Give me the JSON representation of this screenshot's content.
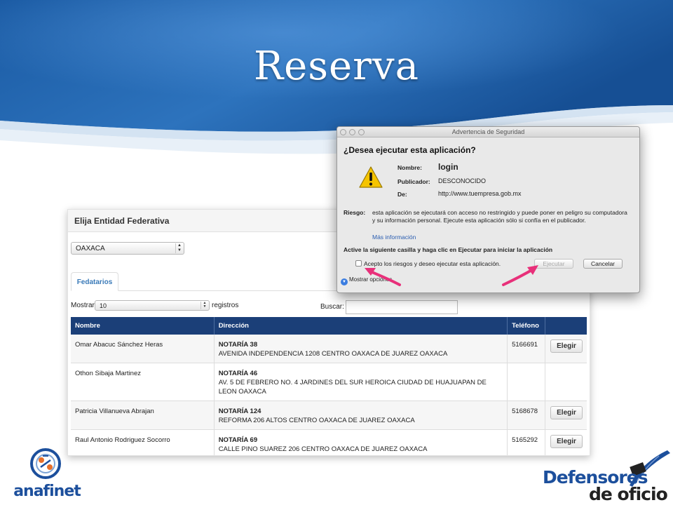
{
  "slide": {
    "title": "Reserva"
  },
  "page": {
    "panel_title": "Elija Entidad Federativa",
    "entity_select_value": "OAXACA",
    "tab_label": "Fedatarios",
    "length_prefix": "Mostrar",
    "length_value": "10",
    "length_suffix": "registros",
    "search_label": "Buscar:",
    "search_value": ""
  },
  "table": {
    "columns": [
      "Nombre",
      "Dirección",
      "Teléfono",
      ""
    ],
    "button_label": "Elegir",
    "rows": [
      {
        "nombre": "Omar Abacuc Sánchez Heras",
        "notaria": "NOTARÍA 38",
        "direccion": "AVENIDA INDEPENDENCIA 1208 CENTRO OAXACA DE JUAREZ OAXACA",
        "telefono": "5166691",
        "has_button": true
      },
      {
        "nombre": "Othon Sibaja Martinez",
        "notaria": "NOTARÍA 46",
        "direccion": "AV. 5 DE FEBRERO NO. 4 JARDINES DEL SUR HEROICA CIUDAD DE HUAJUAPAN DE LEON OAXACA",
        "telefono": "",
        "has_button": false
      },
      {
        "nombre": "Patricia Villanueva Abrajan",
        "notaria": "NOTARÍA 124",
        "direccion": "REFORMA 206 ALTOS CENTRO OAXACA DE JUAREZ OAXACA",
        "telefono": "5168678",
        "has_button": true
      },
      {
        "nombre": "Raul Antonio Rodriguez Socorro",
        "notaria": "NOTARÍA 69",
        "direccion": "CALLE PINO SUAREZ 206 CENTRO OAXACA DE JUAREZ OAXACA",
        "telefono": "5165292",
        "has_button": true
      }
    ]
  },
  "dialog": {
    "window_title": "Advertencia de Seguridad",
    "question": "¿Desea ejecutar esta aplicación?",
    "name_label": "Nombre:",
    "name_value": "login",
    "publisher_label": "Publicador:",
    "publisher_value": "DESCONOCIDO",
    "from_label": "De:",
    "from_value": "http://www.tuempresa.gob.mx",
    "risk_label": "Riesgo:",
    "risk_text": "esta aplicación se ejecutará con acceso no restringido y puede poner en peligro su computadora y su información personal. Ejecute esta aplicación sólo si confía en el publicador.",
    "more_info": "Más información",
    "instruction": "Active la siguiente casilla y haga clic en Ejecutar para iniciar la aplicación",
    "accept_label": "Acepto los riesgos y deseo ejecutar esta aplicación.",
    "run_button": "Ejecutar",
    "cancel_button": "Cancelar",
    "details_toggle": "Mostrar opciones"
  },
  "logos": {
    "left": "anafinet",
    "right_line1": "Defensores",
    "right_line2": "de oficio"
  },
  "colors": {
    "header_blue": "#1d5fa8",
    "table_header": "#1b3f78",
    "arrow_pink": "#e8307a",
    "logo_blue": "#1c4f9c"
  }
}
